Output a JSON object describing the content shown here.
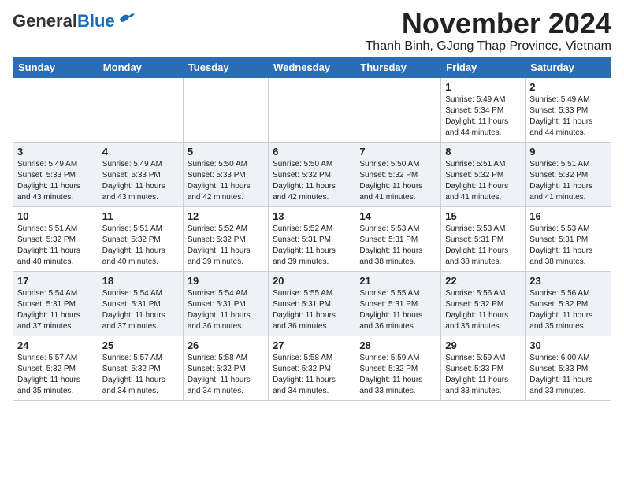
{
  "header": {
    "logo_general": "General",
    "logo_blue": "Blue",
    "month_title": "November 2024",
    "location": "Thanh Binh, GJong Thap Province, Vietnam"
  },
  "calendar": {
    "days_of_week": [
      "Sunday",
      "Monday",
      "Tuesday",
      "Wednesday",
      "Thursday",
      "Friday",
      "Saturday"
    ],
    "weeks": [
      [
        {
          "day": "",
          "info": ""
        },
        {
          "day": "",
          "info": ""
        },
        {
          "day": "",
          "info": ""
        },
        {
          "day": "",
          "info": ""
        },
        {
          "day": "",
          "info": ""
        },
        {
          "day": "1",
          "info": "Sunrise: 5:49 AM\nSunset: 5:34 PM\nDaylight: 11 hours\nand 44 minutes."
        },
        {
          "day": "2",
          "info": "Sunrise: 5:49 AM\nSunset: 5:33 PM\nDaylight: 11 hours\nand 44 minutes."
        }
      ],
      [
        {
          "day": "3",
          "info": "Sunrise: 5:49 AM\nSunset: 5:33 PM\nDaylight: 11 hours\nand 43 minutes."
        },
        {
          "day": "4",
          "info": "Sunrise: 5:49 AM\nSunset: 5:33 PM\nDaylight: 11 hours\nand 43 minutes."
        },
        {
          "day": "5",
          "info": "Sunrise: 5:50 AM\nSunset: 5:33 PM\nDaylight: 11 hours\nand 42 minutes."
        },
        {
          "day": "6",
          "info": "Sunrise: 5:50 AM\nSunset: 5:32 PM\nDaylight: 11 hours\nand 42 minutes."
        },
        {
          "day": "7",
          "info": "Sunrise: 5:50 AM\nSunset: 5:32 PM\nDaylight: 11 hours\nand 41 minutes."
        },
        {
          "day": "8",
          "info": "Sunrise: 5:51 AM\nSunset: 5:32 PM\nDaylight: 11 hours\nand 41 minutes."
        },
        {
          "day": "9",
          "info": "Sunrise: 5:51 AM\nSunset: 5:32 PM\nDaylight: 11 hours\nand 41 minutes."
        }
      ],
      [
        {
          "day": "10",
          "info": "Sunrise: 5:51 AM\nSunset: 5:32 PM\nDaylight: 11 hours\nand 40 minutes."
        },
        {
          "day": "11",
          "info": "Sunrise: 5:51 AM\nSunset: 5:32 PM\nDaylight: 11 hours\nand 40 minutes."
        },
        {
          "day": "12",
          "info": "Sunrise: 5:52 AM\nSunset: 5:32 PM\nDaylight: 11 hours\nand 39 minutes."
        },
        {
          "day": "13",
          "info": "Sunrise: 5:52 AM\nSunset: 5:31 PM\nDaylight: 11 hours\nand 39 minutes."
        },
        {
          "day": "14",
          "info": "Sunrise: 5:53 AM\nSunset: 5:31 PM\nDaylight: 11 hours\nand 38 minutes."
        },
        {
          "day": "15",
          "info": "Sunrise: 5:53 AM\nSunset: 5:31 PM\nDaylight: 11 hours\nand 38 minutes."
        },
        {
          "day": "16",
          "info": "Sunrise: 5:53 AM\nSunset: 5:31 PM\nDaylight: 11 hours\nand 38 minutes."
        }
      ],
      [
        {
          "day": "17",
          "info": "Sunrise: 5:54 AM\nSunset: 5:31 PM\nDaylight: 11 hours\nand 37 minutes."
        },
        {
          "day": "18",
          "info": "Sunrise: 5:54 AM\nSunset: 5:31 PM\nDaylight: 11 hours\nand 37 minutes."
        },
        {
          "day": "19",
          "info": "Sunrise: 5:54 AM\nSunset: 5:31 PM\nDaylight: 11 hours\nand 36 minutes."
        },
        {
          "day": "20",
          "info": "Sunrise: 5:55 AM\nSunset: 5:31 PM\nDaylight: 11 hours\nand 36 minutes."
        },
        {
          "day": "21",
          "info": "Sunrise: 5:55 AM\nSunset: 5:31 PM\nDaylight: 11 hours\nand 36 minutes."
        },
        {
          "day": "22",
          "info": "Sunrise: 5:56 AM\nSunset: 5:32 PM\nDaylight: 11 hours\nand 35 minutes."
        },
        {
          "day": "23",
          "info": "Sunrise: 5:56 AM\nSunset: 5:32 PM\nDaylight: 11 hours\nand 35 minutes."
        }
      ],
      [
        {
          "day": "24",
          "info": "Sunrise: 5:57 AM\nSunset: 5:32 PM\nDaylight: 11 hours\nand 35 minutes."
        },
        {
          "day": "25",
          "info": "Sunrise: 5:57 AM\nSunset: 5:32 PM\nDaylight: 11 hours\nand 34 minutes."
        },
        {
          "day": "26",
          "info": "Sunrise: 5:58 AM\nSunset: 5:32 PM\nDaylight: 11 hours\nand 34 minutes."
        },
        {
          "day": "27",
          "info": "Sunrise: 5:58 AM\nSunset: 5:32 PM\nDaylight: 11 hours\nand 34 minutes."
        },
        {
          "day": "28",
          "info": "Sunrise: 5:59 AM\nSunset: 5:32 PM\nDaylight: 11 hours\nand 33 minutes."
        },
        {
          "day": "29",
          "info": "Sunrise: 5:59 AM\nSunset: 5:33 PM\nDaylight: 11 hours\nand 33 minutes."
        },
        {
          "day": "30",
          "info": "Sunrise: 6:00 AM\nSunset: 5:33 PM\nDaylight: 11 hours\nand 33 minutes."
        }
      ]
    ]
  }
}
